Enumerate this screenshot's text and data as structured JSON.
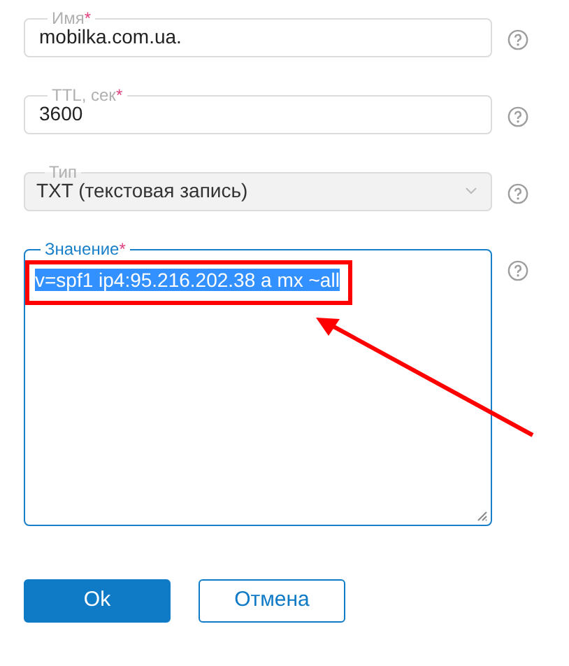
{
  "fields": [
    {
      "kind": "input",
      "label": "Имя",
      "required_mark": "*",
      "value": "mobilka.com.ua.",
      "disabled": false
    },
    {
      "kind": "input",
      "label": "TTL, сек",
      "required_mark": "*",
      "value": "3600",
      "disabled": false
    },
    {
      "kind": "select",
      "label": "Тип",
      "value": "TXT (текстовая запись)",
      "disabled": true
    },
    {
      "kind": "textarea",
      "label": "Значение",
      "required_mark": "*",
      "value": "v=spf1 ip4:95.216.202.38 a mx ~all",
      "disabled": false,
      "focused": true,
      "selected": true
    }
  ],
  "buttons": [
    {
      "label": "Ok",
      "primary": true
    },
    {
      "label": "Отмена",
      "primary": false
    }
  ]
}
